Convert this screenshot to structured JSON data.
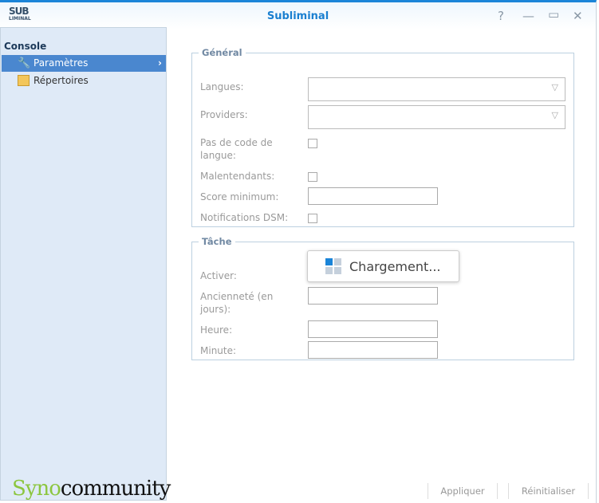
{
  "window": {
    "title": "Subliminal",
    "logo_text": "SUB",
    "logo_sub": "LIMINAL"
  },
  "titlebar_icons": [
    "help-icon",
    "minimize-icon",
    "maximize-icon",
    "close-icon"
  ],
  "sidebar": {
    "header": "Console",
    "items": [
      {
        "label": "Paramètres",
        "icon": "wrench-icon",
        "selected": true
      },
      {
        "label": "Répertoires",
        "icon": "folder-icon",
        "selected": false
      }
    ],
    "footer_logo_a": "Syno",
    "footer_logo_b": "community"
  },
  "general": {
    "legend": "Général",
    "langues": "Langues:",
    "providers": "Providers:",
    "pas_code": "Pas de code de langue:",
    "malentendants": "Malentendants:",
    "score": "Score minimum:",
    "notifications": "Notifications DSM:"
  },
  "tache": {
    "legend": "Tâche",
    "activer": "Activer:",
    "anciennete": "Ancienneté (en jours):",
    "heure": "Heure:",
    "minute": "Minute:"
  },
  "loading": {
    "text": "Chargement..."
  },
  "buttons": {
    "apply": "Appliquer",
    "reset": "Réinitialiser"
  },
  "colors": {
    "accent": "#1a84d8",
    "selected": "#4a87cf",
    "sidebar_bg": "#dfeaf7"
  }
}
